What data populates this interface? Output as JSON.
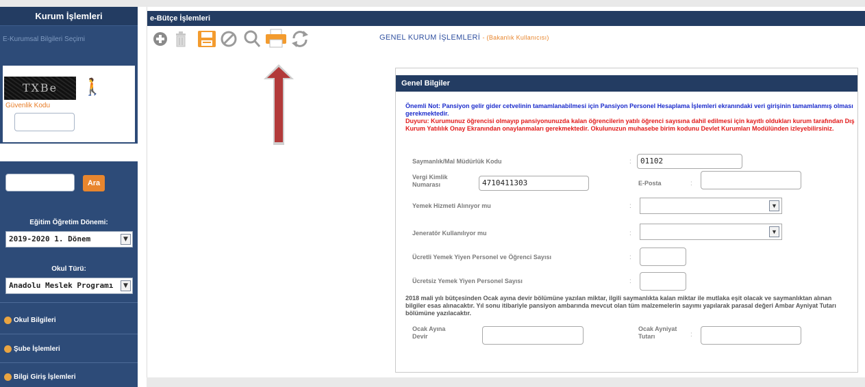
{
  "sidebar": {
    "header": "Kurum İşlemleri",
    "sub_title": "E-Kurumsal Bilgileri Seçimi",
    "captcha_label": "Güvenlik Kodu",
    "captcha_text": "TXBe",
    "search_button": "Ara",
    "term_label": "Eğitim Öğretim Dönemi:",
    "term_value": "2019-2020 1. Dönem",
    "school_type_label": "Okul Türü:",
    "school_type_value": "Anadolu Meslek Programı",
    "menu": [
      {
        "label": "Okul Bilgileri"
      },
      {
        "label": "Şube İşlemleri"
      },
      {
        "label": "Bilgi Giriş İşlemleri"
      }
    ]
  },
  "main": {
    "header": "e-Bütçe İşlemleri",
    "page_title": "GENEL KURUM İŞLEMLERİ",
    "page_subtitle": "- (Bakanlık Kullanıcısı)",
    "toolbar": [
      "add-icon",
      "delete-icon",
      "save-icon",
      "cancel-icon",
      "search-icon",
      "print-icon",
      "refresh-icon"
    ]
  },
  "panel": {
    "header": "Genel Bilgiler",
    "note_blue": "Önemli Not: Pansiyon gelir gider cetvelinin tamamlanabilmesi için Pansiyon Personel Hesaplama İşlemleri ekranındaki veri girişinin tamamlanmış olması gerekmektedir.",
    "note_red": "Duyuru: Kurumunuz öğrencisi olmayıp pansiyonunuzda kalan öğrencilerin yatılı öğrenci sayısına dahil edilmesi için kayıtlı oldukları kurum tarafından Dış Kurum Yatılılık Onay Ekranından onaylanmaları gerekmektedir. Okulunuzun muhasebe birim kodunu Devlet Kurumları Modülünden izleyebilirsiniz.",
    "fields": {
      "saymanlik_label": "Saymanlık/Mal Müdürlük Kodu",
      "saymanlik_value": "01102",
      "vergi_label": "Vergi Kimlik Numarası",
      "vergi_value": "4710411303",
      "eposta_label": "E-Posta",
      "eposta_value": "",
      "yemek_label": "Yemek Hizmeti Alınıyor mu",
      "jenerator_label": "Jeneratör Kullanılıyor mu",
      "ucretli_label": "Ücretli Yemek Yiyen Personel ve Öğrenci Sayısı",
      "ucretsiz_label": "Ücretsiz Yemek Yiyen Personel Sayısı",
      "ocak_devir_label": "Ocak Ayına Devir",
      "ocak_ayniyat_label": "Ocak Ayniyat Tutarı"
    },
    "paragraph": "2018 mali yılı bütçesinden Ocak ayına devir bölümüne yazılan miktar, ilgili saymanlıkta kalan miktar ile mutlaka eşit olacak ve saymanlıktan alınan bilgiler esas alınacaktır. Yıl sonu itibariyle pansiyon ambarında mevcut olan tüm malzemelerin sayımı yapılarak parasal değeri Ambar Ayniyat Tutarı bölümüne yazılacaktır."
  },
  "colors": {
    "nav_dark": "#233c62",
    "sidebar": "#2d4b78",
    "accent_orange": "#e8862e",
    "note_blue": "#1d2dcc",
    "note_red": "#e21b1b",
    "arrow_red": "#b23a3a"
  }
}
